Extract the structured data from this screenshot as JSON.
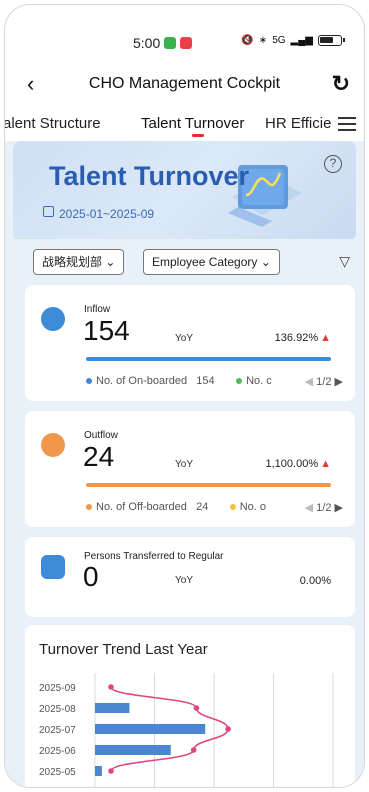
{
  "status_bar": {
    "time": "5:00",
    "network": "5G"
  },
  "header": {
    "title": "CHO Management Cockpit"
  },
  "tabs": [
    {
      "label": "alent Structure"
    },
    {
      "label": "Talent Turnover"
    },
    {
      "label": "HR Efficie"
    }
  ],
  "banner": {
    "title": "Talent Turnover",
    "date_range": "2025-01~2025-09"
  },
  "filters": {
    "department": "战略规划部",
    "category": "Employee Category"
  },
  "inflow": {
    "label": "Inflow",
    "value": "154",
    "yoy_label": "YoY",
    "yoy_pct": "136.92%",
    "legend_primary": "No. of On-boarded",
    "legend_primary_value": "154",
    "legend_secondary": "No. c",
    "pager": "1/2",
    "color": "#3d8bd6",
    "secondary_color": "#52b85a"
  },
  "outflow": {
    "label": "Outflow",
    "value": "24",
    "yoy_label": "YoY",
    "yoy_pct": "1,100.00%",
    "legend_primary": "No. of Off-boarded",
    "legend_primary_value": "24",
    "legend_secondary": "No. o",
    "pager": "1/2",
    "color": "#f0984a",
    "secondary_color": "#f3c23e"
  },
  "regular": {
    "label": "Persons Transferred to Regular",
    "value": "0",
    "yoy_label": "YoY",
    "yoy_pct": "0.00%",
    "color": "#3d8bd6"
  },
  "trend": {
    "title": "Turnover Trend Last Year"
  },
  "chart_data": {
    "type": "bar",
    "orientation": "horizontal",
    "categories": [
      "2025-09",
      "2025-08",
      "2025-07",
      "2025-06",
      "2025-05"
    ],
    "series": [
      {
        "values": [
          0,
          25,
          80,
          55,
          5
        ],
        "color": "#4a86d2"
      }
    ],
    "overlay_line": {
      "values": [
        0,
        62,
        85,
        60,
        0
      ],
      "color": "#e0457f"
    },
    "xlim": [
      0,
      180
    ],
    "grid": true
  }
}
